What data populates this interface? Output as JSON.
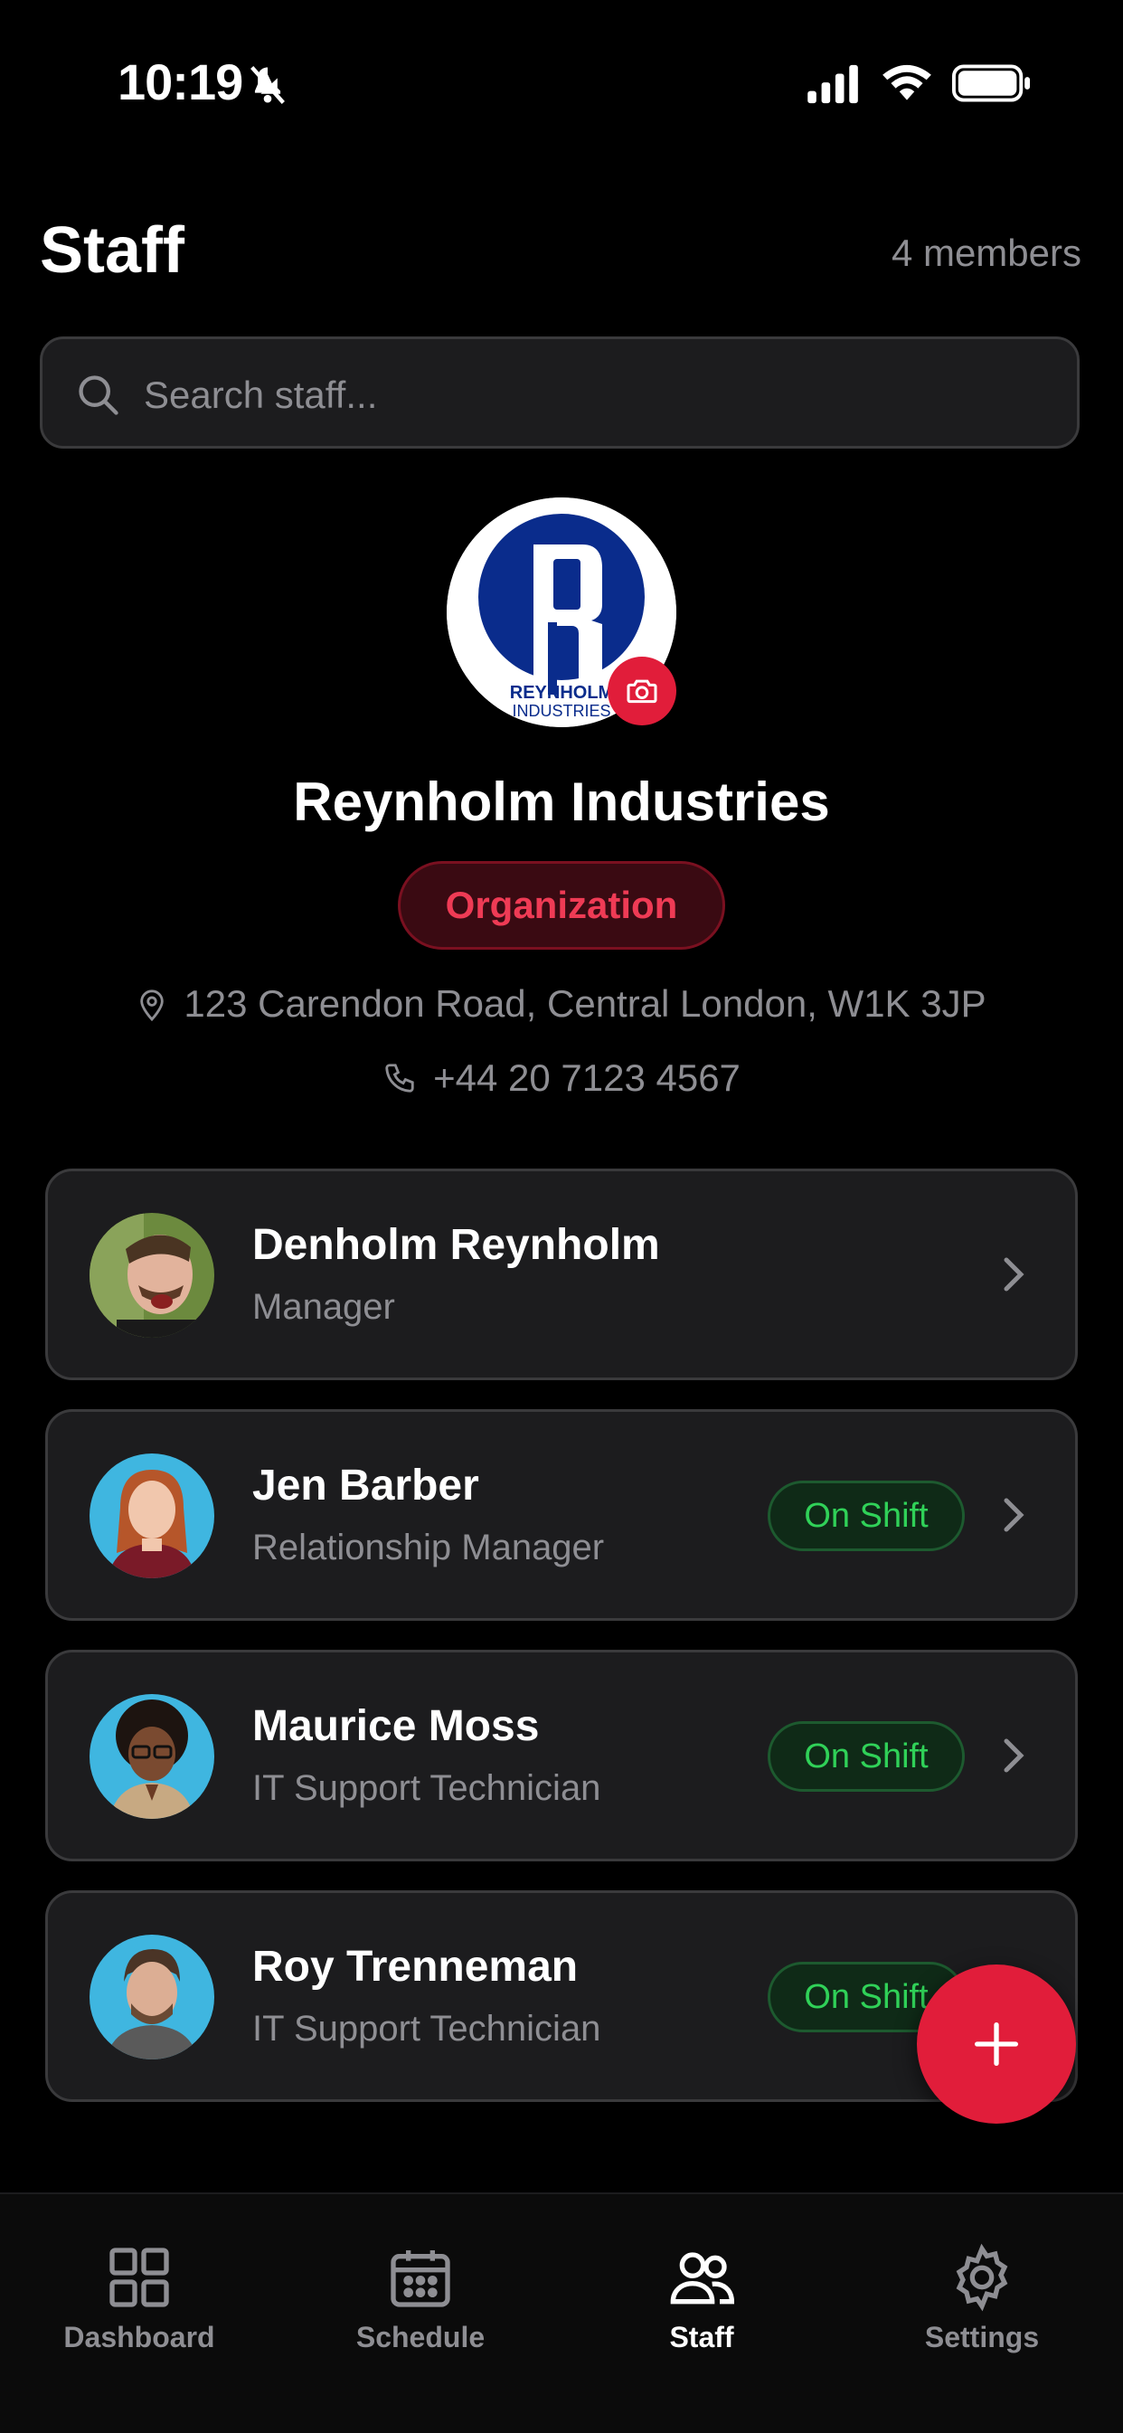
{
  "status_bar": {
    "time": "10:19"
  },
  "header": {
    "title": "Staff",
    "member_count": "4 members"
  },
  "search": {
    "placeholder": "Search staff..."
  },
  "organization": {
    "name": "Reynholm Industries",
    "badge": "Organization",
    "address": "123 Carendon Road, Central London, W1K 3JP",
    "phone": "+44 20 7123 4567",
    "logo_text_1": "REYNHOLM",
    "logo_text_2": "INDUSTRIES"
  },
  "staff": [
    {
      "name": "Denholm Reynholm",
      "role": "Manager",
      "status": ""
    },
    {
      "name": "Jen Barber",
      "role": "Relationship Manager",
      "status": "On Shift"
    },
    {
      "name": "Maurice Moss",
      "role": "IT Support Technician",
      "status": "On Shift"
    },
    {
      "name": "Roy Trenneman",
      "role": "IT Support Technician",
      "status": "On Shift"
    }
  ],
  "tabs": [
    {
      "label": "Dashboard",
      "icon": "grid-icon"
    },
    {
      "label": "Schedule",
      "icon": "calendar-icon"
    },
    {
      "label": "Staff",
      "icon": "people-icon"
    },
    {
      "label": "Settings",
      "icon": "gear-icon"
    }
  ],
  "colors": {
    "accent": "#e11d3a",
    "on_shift": "#30d158",
    "card_bg": "#1c1c1e",
    "secondary_text": "#8e8e93"
  }
}
